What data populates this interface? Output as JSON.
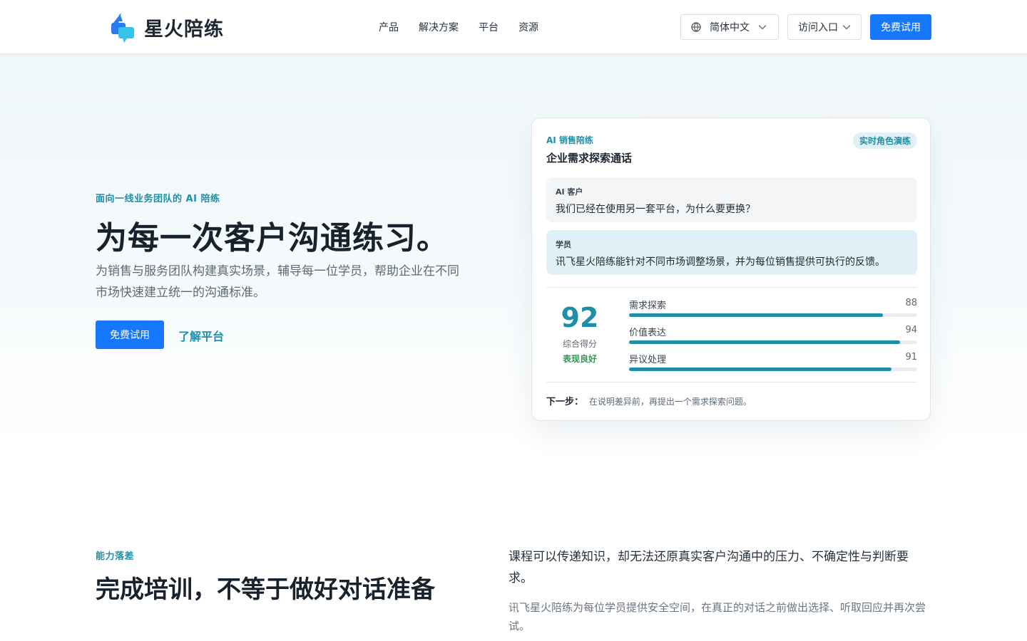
{
  "header": {
    "brand_name": "星火陪练",
    "nav": [
      "产品",
      "解决方案",
      "平台",
      "资源"
    ],
    "language_label": "简体中文",
    "portal_label": "访问入口",
    "trial_label": "免费试用"
  },
  "hero": {
    "eyebrow": "面向一线业务团队的 AI 陪练",
    "title": "为每一次客户沟通练习。",
    "description": "为销售与服务团队构建真实场景，辅导每一位学员，帮助企业在不同市场快速建立统一的沟通标准。",
    "primary_cta": "免费试用",
    "secondary_cta": "了解平台"
  },
  "demo_card": {
    "eyebrow": "AI 销售陪练",
    "title": "企业需求探索通话",
    "badge": "实时角色演练",
    "messages": [
      {
        "role": "AI 客户",
        "text": "我们已经在使用另一套平台，为什么要更换？"
      },
      {
        "role": "学员",
        "text": "讯飞星火陪练能针对不同市场调整场景，并为每位销售提供可执行的反馈。"
      }
    ],
    "overall_score": "92",
    "overall_label": "综合得分",
    "overall_level": "表现良好",
    "metrics": [
      {
        "label": "需求探索",
        "value": "88",
        "fraction": 0.88
      },
      {
        "label": "价值表达",
        "value": "94",
        "fraction": 0.94
      },
      {
        "label": "异议处理",
        "value": "91",
        "fraction": 0.91
      }
    ],
    "next_step_label": "下一步：",
    "next_step_text": "在说明差异前，再提出一个需求探索问题。"
  },
  "section2": {
    "eyebrow": "能力落差",
    "title": "完成培训，不等于做好对话准备",
    "lead": "课程可以传递知识，却无法还原真实客户沟通中的压力、不确定性与判断要求。",
    "body": "讯飞星火陪练为每位学员提供安全空间，在真正的对话之前做出选择、听取回应并再次尝试。"
  },
  "colors": {
    "primary": "#1677ff",
    "accent": "#1f8fa8",
    "success": "#2e9a55"
  }
}
